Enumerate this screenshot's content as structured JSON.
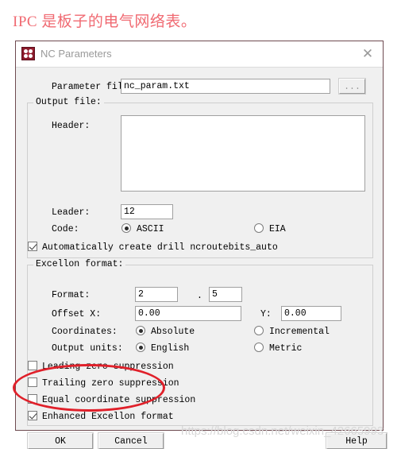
{
  "page": {
    "heading": "IPC 是板子的电气网络表。",
    "heading_color": "#f06a72",
    "watermark": "https://blog.csdn.net/weixin_42665993"
  },
  "dialog": {
    "title": "NC Parameters",
    "icon": "nc-parameters-app-icon",
    "close_label": "✕",
    "parameter_file": {
      "label": "Parameter file:",
      "value": "nc_param.txt",
      "browse_label": "..."
    },
    "output_file_group": {
      "title": "Output file:",
      "header": {
        "label": "Header:",
        "value": ""
      },
      "leader": {
        "label": "Leader:",
        "value": "12"
      },
      "code": {
        "label": "Code:",
        "options": [
          {
            "label": "ASCII",
            "selected": true
          },
          {
            "label": "EIA",
            "selected": false
          }
        ]
      },
      "auto_create": {
        "label": "Automatically create drill ncroutebits_auto",
        "checked": true
      }
    },
    "excellon_group": {
      "title": "Excellon format:",
      "format": {
        "label": "Format:",
        "integer": "2",
        "separator": ".",
        "decimal": "5"
      },
      "offset": {
        "label_x": "Offset X:",
        "value_x": "0.00",
        "label_y": "Y:",
        "value_y": "0.00"
      },
      "coordinates": {
        "label": "Coordinates:",
        "options": [
          {
            "label": "Absolute",
            "selected": true
          },
          {
            "label": "Incremental",
            "selected": false
          }
        ]
      },
      "output_units": {
        "label": "Output units:",
        "options": [
          {
            "label": "English",
            "selected": true
          },
          {
            "label": "Metric",
            "selected": false
          }
        ]
      },
      "checkboxes": [
        {
          "label": "Leading zero suppression",
          "checked": false
        },
        {
          "label": "Trailing zero suppression",
          "checked": false
        },
        {
          "label": "Equal coordinate suppression",
          "checked": false
        },
        {
          "label": "Enhanced Excellon format",
          "checked": true
        }
      ]
    },
    "buttons": {
      "ok": "OK",
      "cancel": "Cancel",
      "help": "Help"
    }
  },
  "annotation": {
    "shape": "ellipse",
    "color": "#e0202a"
  }
}
